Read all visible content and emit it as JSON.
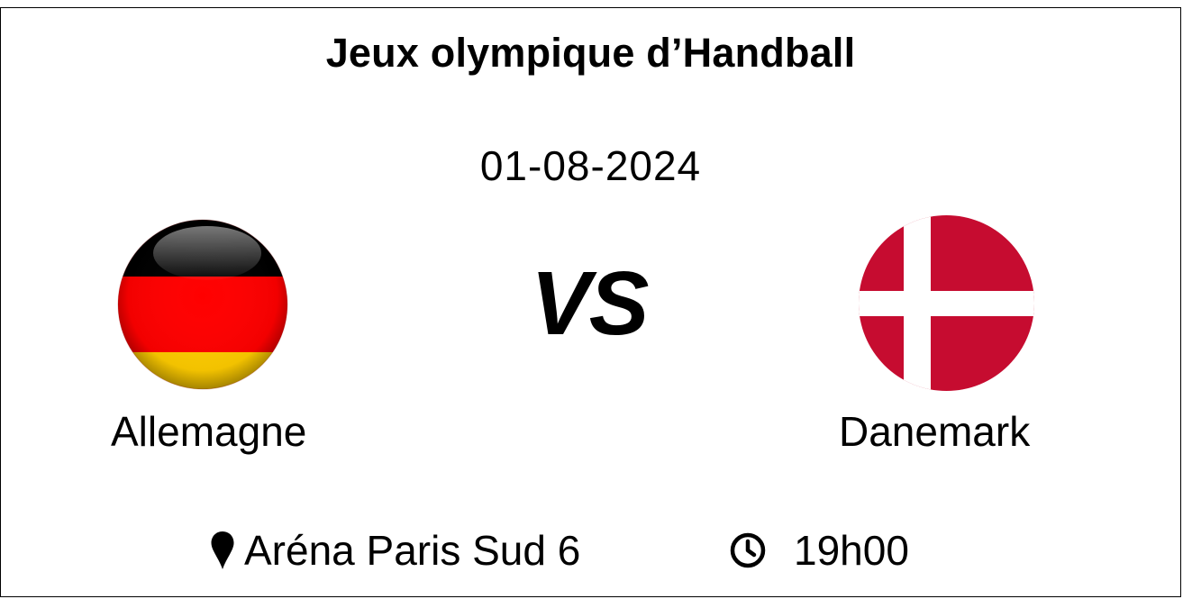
{
  "match": {
    "title": "Jeux olympique d’Handball",
    "date": "01-08-2024",
    "versus": "VS",
    "home_team": {
      "name": "Allemagne",
      "flag_icon": "germany-flag-icon",
      "flag_colors": [
        "#000000",
        "#ff0000",
        "#ffcc00"
      ]
    },
    "away_team": {
      "name": "Danemark",
      "flag_icon": "denmark-flag-icon",
      "flag_colors": [
        "#c60c30",
        "#ffffff"
      ]
    },
    "venue": {
      "icon": "location-pin-icon",
      "label": "Aréna Paris Sud 6"
    },
    "time": {
      "icon": "clock-icon",
      "label": "19h00"
    }
  }
}
